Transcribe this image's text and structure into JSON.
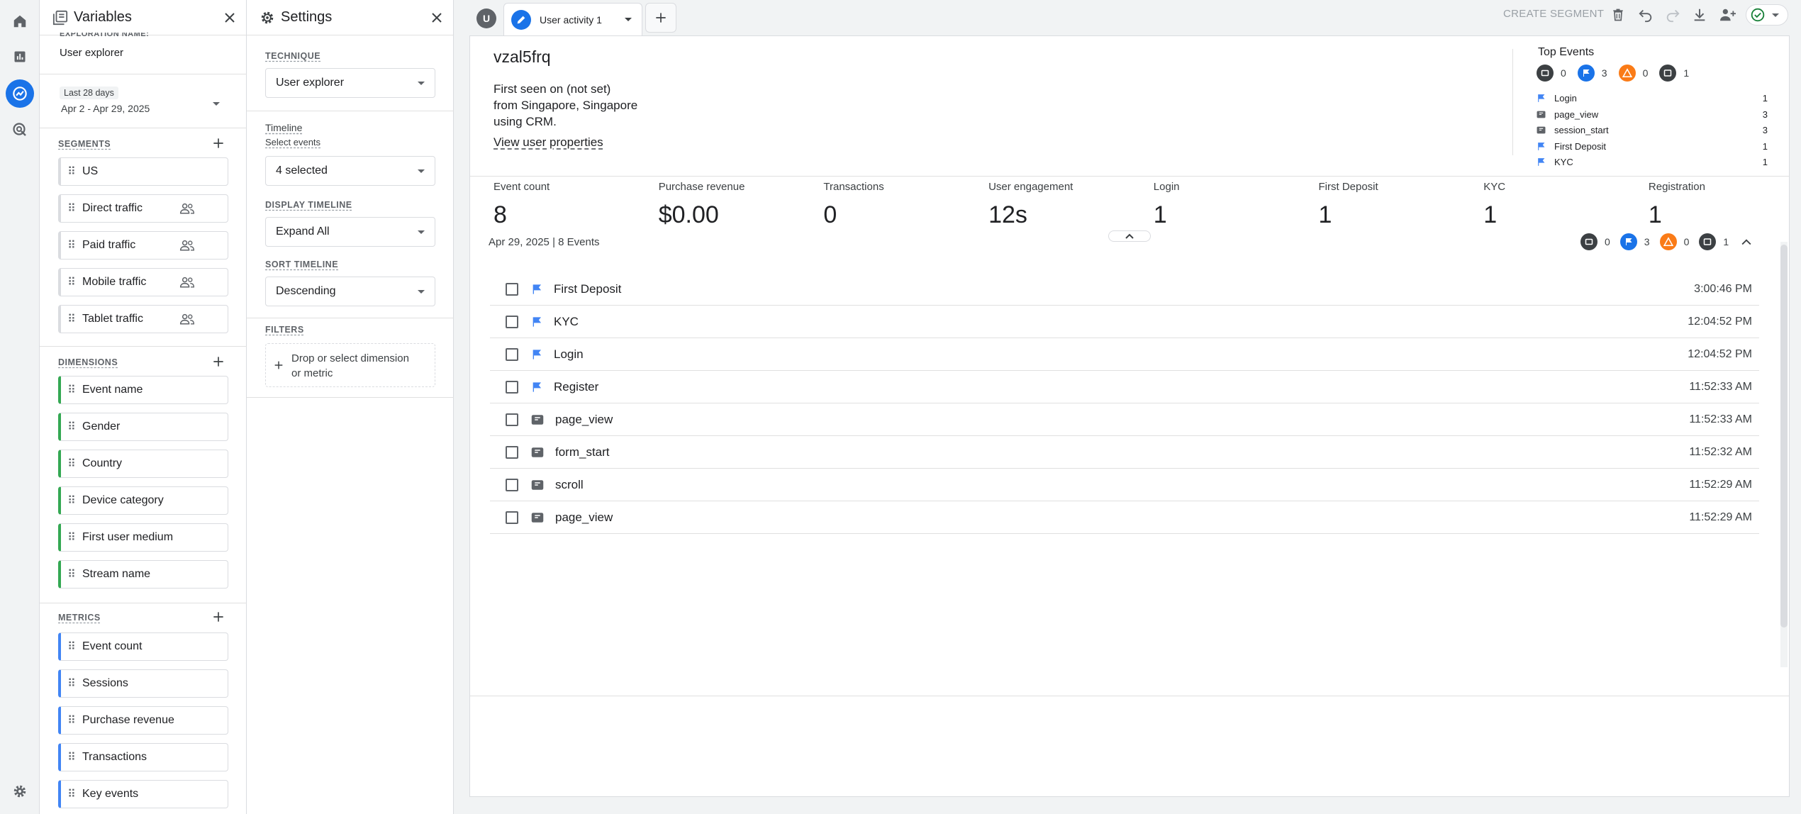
{
  "rail": {
    "items": [
      "home-icon",
      "reports-icon",
      "explore-icon",
      "advertising-icon",
      "admin-icon"
    ]
  },
  "variables": {
    "title": "Variables",
    "exploration_name_label": "EXPLORATION NAME:",
    "exploration_name": "User explorer",
    "date_badge": "Last 28 days",
    "date_range": "Apr 2 - Apr 29, 2025",
    "segments_label": "SEGMENTS",
    "segments": [
      "US",
      "Direct traffic",
      "Paid traffic",
      "Mobile traffic",
      "Tablet traffic"
    ],
    "dimensions_label": "DIMENSIONS",
    "dimensions": [
      "Event name",
      "Gender",
      "Country",
      "Device category",
      "First user medium",
      "Stream name"
    ],
    "metrics_label": "METRICS",
    "metrics": [
      "Event count",
      "Sessions",
      "Purchase revenue",
      "Transactions",
      "Key events"
    ]
  },
  "settings": {
    "title": "Settings",
    "technique_label": "TECHNIQUE",
    "technique_value": "User explorer",
    "timeline_label": "Timeline",
    "select_events_label": "Select events",
    "select_events_value": "4 selected",
    "display_timeline_label": "DISPLAY TIMELINE",
    "display_timeline_value": "Expand All",
    "sort_timeline_label": "SORT TIMELINE",
    "sort_timeline_value": "Descending",
    "filters_label": "FILTERS",
    "filters_placeholder_1": "Drop or select dimension",
    "filters_placeholder_2": "or metric"
  },
  "tabs": {
    "avatar_letter": "U",
    "active_tab": "User activity 1",
    "create_segment": "CREATE SEGMENT"
  },
  "user": {
    "id": "vzal5frq",
    "first_seen": "First seen on (not set)",
    "from": "from Singapore, Singapore",
    "using": "using CRM.",
    "view_properties": "View user properties"
  },
  "top_events": {
    "title": "Top Events",
    "summary": {
      "screen": "0",
      "flag": "3",
      "warning": "0",
      "page": "1"
    },
    "rows": [
      {
        "icon": "flag",
        "name": "Login",
        "count": "1"
      },
      {
        "icon": "page",
        "name": "page_view",
        "count": "3"
      },
      {
        "icon": "page",
        "name": "session_start",
        "count": "3"
      },
      {
        "icon": "flag",
        "name": "First Deposit",
        "count": "1"
      },
      {
        "icon": "flag",
        "name": "KYC",
        "count": "1"
      }
    ]
  },
  "metrics_strip": [
    {
      "label": "Event count",
      "value": "8"
    },
    {
      "label": "Purchase revenue",
      "value": "$0.00"
    },
    {
      "label": "Transactions",
      "value": "0"
    },
    {
      "label": "User engagement",
      "value": "12s"
    },
    {
      "label": "Login",
      "value": "1"
    },
    {
      "label": "First Deposit",
      "value": "1"
    },
    {
      "label": "KYC",
      "value": "1"
    },
    {
      "label": "Registration",
      "value": "1"
    }
  ],
  "timeline": {
    "date_header": "Apr 29, 2025 | 8 Events",
    "summary": {
      "screen": "0",
      "flag": "3",
      "warning": "0",
      "page": "1"
    },
    "events": [
      {
        "icon": "flag",
        "name": "First Deposit",
        "time": "3:00:46 PM"
      },
      {
        "icon": "flag",
        "name": "KYC",
        "time": "12:04:52 PM"
      },
      {
        "icon": "flag",
        "name": "Login",
        "time": "12:04:52 PM"
      },
      {
        "icon": "flag",
        "name": "Register",
        "time": "11:52:33 AM"
      },
      {
        "icon": "page",
        "name": "page_view",
        "time": "11:52:33 AM"
      },
      {
        "icon": "page",
        "name": "form_start",
        "time": "11:52:32 AM"
      },
      {
        "icon": "page",
        "name": "scroll",
        "time": "11:52:29 AM"
      },
      {
        "icon": "page",
        "name": "page_view",
        "time": "11:52:29 AM"
      }
    ]
  },
  "colors": {
    "accent": "#1a73e8",
    "flag": "#4285f4",
    "warning": "#fa7b17",
    "dimension": "#34a853",
    "metric": "#4285f4"
  }
}
